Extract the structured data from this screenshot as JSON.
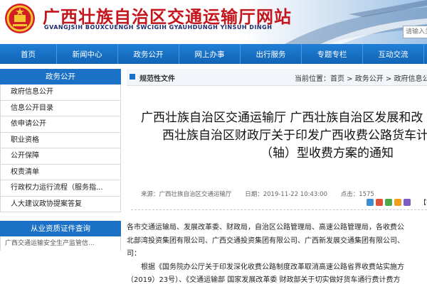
{
  "header": {
    "title": "广西壮族自治区交通运输厅网站",
    "subtitle": "GVANGJSIH BOUXCUENGH SWCIGIH GYAUHDUNGH YINSUH DINGH",
    "search_placeholder": "请输入关键"
  },
  "nav": {
    "items": [
      "首页",
      "新闻中心",
      "政务公开",
      "网上办事",
      "出行服务",
      "专题专栏",
      "互动交流"
    ]
  },
  "sidebar": {
    "title": "政务公开",
    "items": [
      "政府信息公开",
      "信息公开目录",
      "依申请公开",
      "职业资格",
      "公开保障",
      "权责清单",
      "行政权力运行流程（服务指...",
      "人大建议政协提案答复"
    ],
    "title2": "从业资质证件查询",
    "cut_item": "广西交通运输安全生产监管信..."
  },
  "main": {
    "section_title": "规范性文件",
    "breadcrumb": "当前位置：首页 > 政务公开 > 政府信息公",
    "doc_title_lines": [
      "广西壮族自治区交通运输厅 广西壮族自治区发展和改",
      "西壮族自治区财政厅关于印发广西收费公路货车计费方",
      "（轴）型收费方案的通知"
    ],
    "meta": {
      "source_label": "来源：广西壮族自治区交通运输厅",
      "date_label": "日期：2019-11-22 10:43:00",
      "views_label": "点击：1575"
    },
    "font_label": "【字体",
    "body_lines": [
      "各市交通运输局、发展改革委、财政局，自治区公路管理局、高速公路管理局，各收费公",
      "北部湾投资集团有限公司、广西交通投资集团有限公司、广西新发展交通集团有限公司、",
      "司：",
      "　　根据《国务院办公厅关于印发深化收费公路制度改革取消高速公路省界收费站实施方",
      "（2019）23号）、《交通运输部 国家发展改革委 财政部关于切实做好货车通行费计费方"
    ]
  }
}
